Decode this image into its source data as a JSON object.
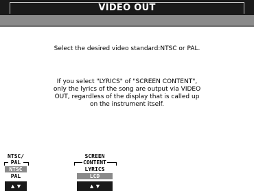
{
  "title": "VIDEO OUT",
  "message": {
    "line1": "Select the desired video standard:NTSC or PAL.",
    "line2a": "If you select \"LYRICS\" of \"SCREEN CONTENT\",",
    "line2b": "only the lyrics of the song are output via VIDEO",
    "line2c": "OUT, regardless of the display that is called up",
    "line2d": "on the instrument itself."
  },
  "ntsc_pal": {
    "label_line1": "NTSC/",
    "label_line2": "PAL",
    "options": [
      "NTSC",
      "PAL"
    ],
    "selected": "NTSC",
    "arrows": "▲▼"
  },
  "screen_content": {
    "label_line1": "SCREEN",
    "label_line2": "CONTENT",
    "options": [
      "LYRICS",
      "LCD"
    ],
    "selected": "LCD",
    "arrows": "▲▼"
  },
  "colors": {
    "title_bar": "#1a1a1a",
    "band": "#8a8a8a",
    "selected_option": "#8a8a8a"
  }
}
